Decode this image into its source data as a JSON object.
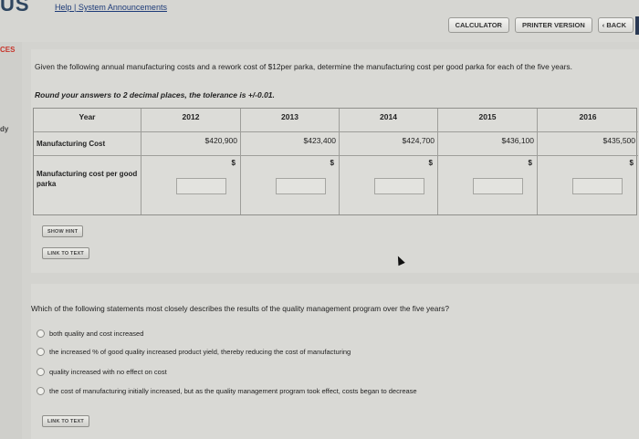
{
  "header": {
    "logo": "US",
    "help_link": "Help",
    "separator": "|",
    "announcements_link": "System Announcements",
    "calculator_label": "CALCULATOR",
    "printer_label": "PRINTER VERSION",
    "back_label": "‹ BACK"
  },
  "side": {
    "ces": "CES",
    "dy": "dy"
  },
  "question1": {
    "prompt": "Given the following annual manufacturing costs and a rework cost of $12per parka, determine the manufacturing cost per good parka for each of the five years.",
    "rounding": "Round your answers to 2 decimal places, the tolerance is +/-0.01.",
    "table": {
      "year_header": "Year",
      "years": [
        "2012",
        "2013",
        "2014",
        "2015",
        "2016"
      ],
      "cost_label": "Manufacturing Cost",
      "costs": [
        "$420,900",
        "$423,400",
        "$424,700",
        "$436,100",
        "$435,500"
      ],
      "per_parka_label": "Manufacturing cost per good parka",
      "currency_symbol": "$",
      "inputs": [
        "",
        "",
        "",
        "",
        ""
      ]
    },
    "show_hint": "SHOW HINT",
    "link_to_text": "LINK TO TEXT"
  },
  "question2": {
    "prompt": "Which of the following statements most closely describes the results of the quality management program over the five years?",
    "options": [
      "both quality and cost increased",
      "the increased % of good quality increased product yield, thereby reducing the cost of manufacturing",
      "quality increased with no effect on cost",
      "the cost of manufacturing initially increased, but as the quality management program took effect, costs began to decrease"
    ],
    "link_to_text": "LINK TO TEXT"
  }
}
